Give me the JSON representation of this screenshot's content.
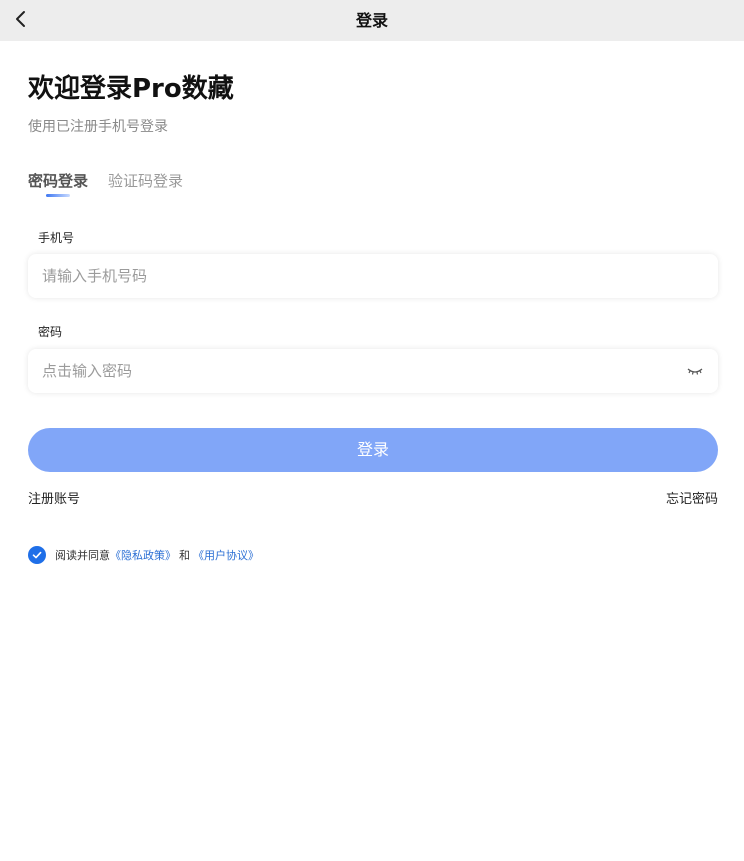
{
  "header": {
    "title": "登录",
    "back_icon": "chevron-left-icon"
  },
  "welcome": {
    "title": "欢迎登录Pro数藏",
    "subtitle": "使用已注册手机号登录"
  },
  "tabs": [
    {
      "label": "密码登录",
      "active": true
    },
    {
      "label": "验证码登录",
      "active": false
    }
  ],
  "form": {
    "phone": {
      "label": "手机号",
      "placeholder": "请输入手机号码",
      "value": ""
    },
    "password": {
      "label": "密码",
      "placeholder": "点击输入密码",
      "value": "",
      "toggle_icon": "eye-closed-icon"
    }
  },
  "actions": {
    "login_label": "登录",
    "register_label": "注册账号",
    "forgot_label": "忘记密码"
  },
  "agreement": {
    "checked": true,
    "prefix": "阅读并同意",
    "privacy_link": "《隐私政策》",
    "and": "和",
    "terms_link": "《用户协议》"
  },
  "colors": {
    "header_bg": "#ededed",
    "accent": "#1f6fe8",
    "button_bg": "#81a6f8",
    "link": "#2b6fd4"
  }
}
